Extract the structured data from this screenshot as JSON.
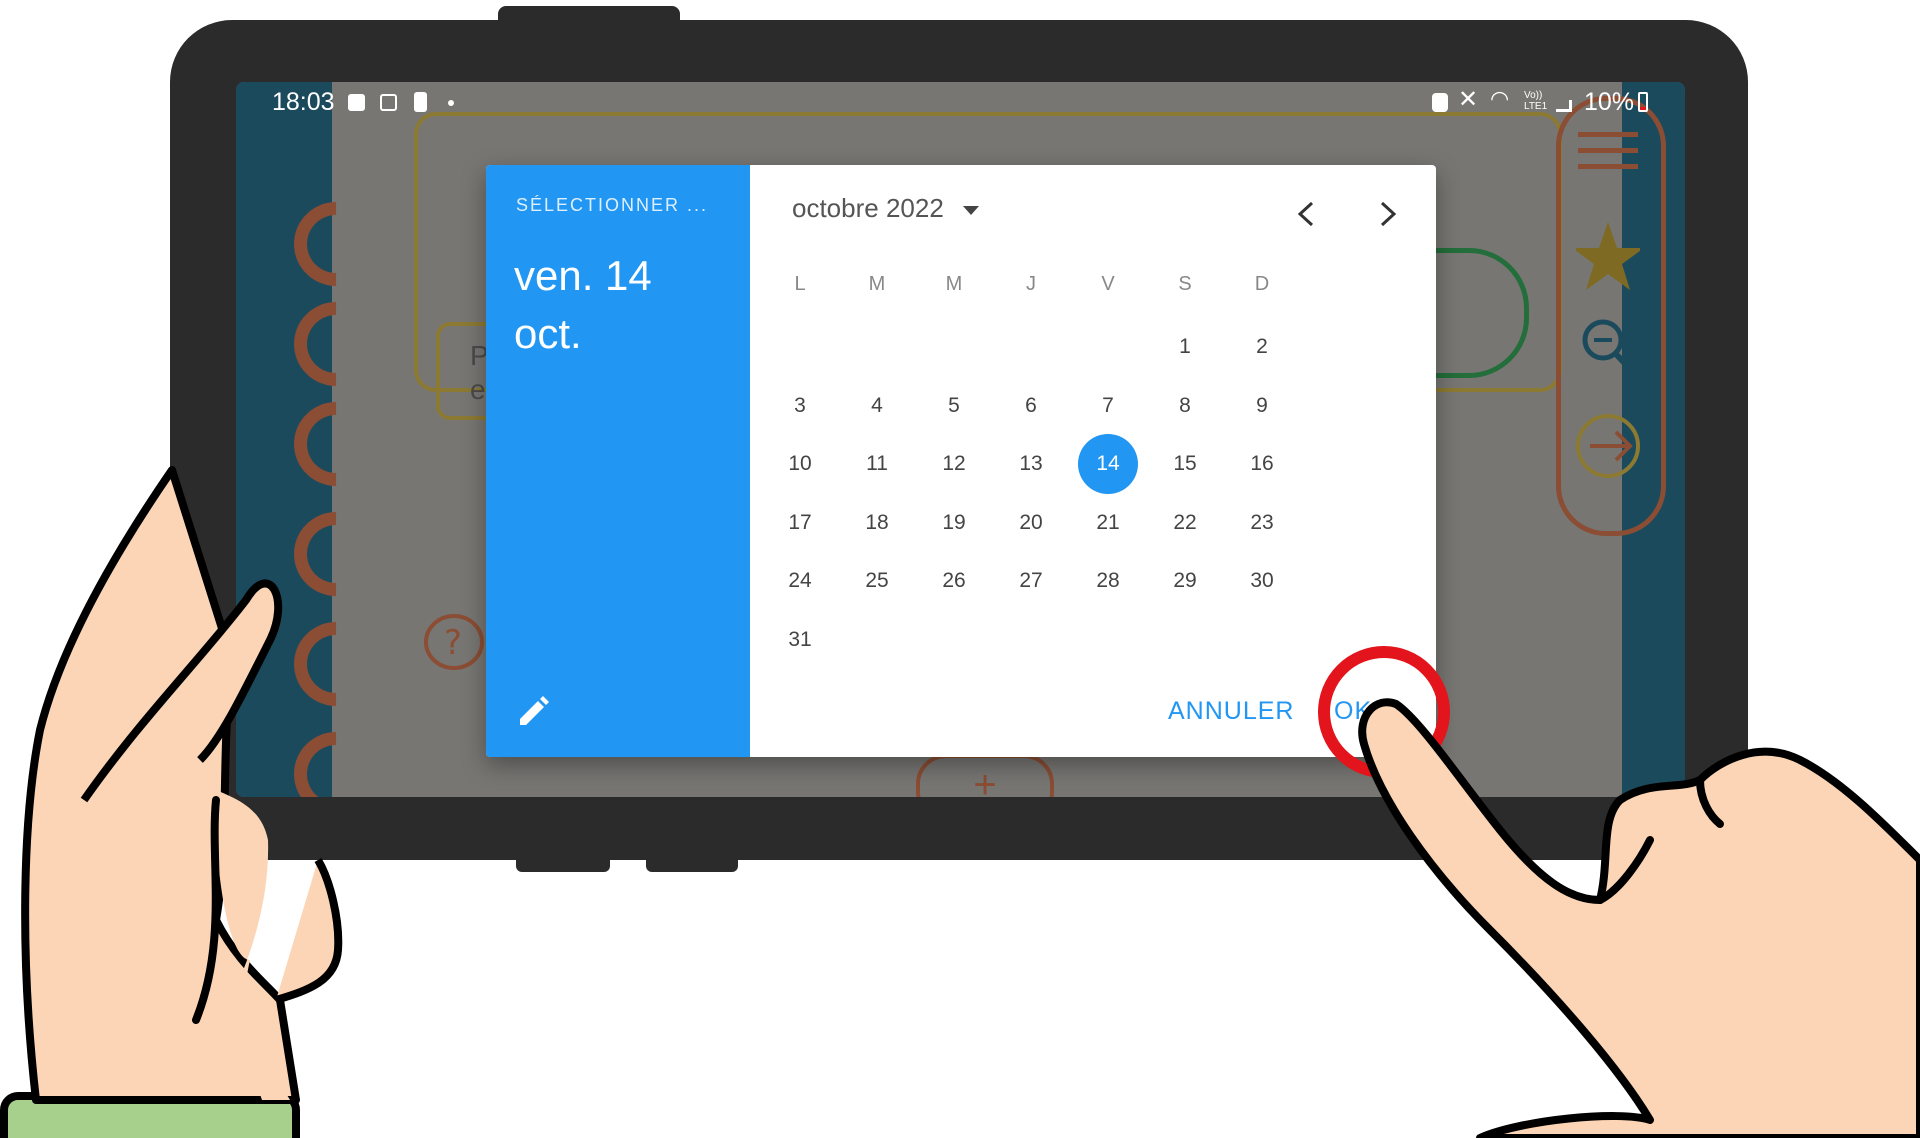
{
  "status_bar": {
    "time": "18:03",
    "left_icons": [
      "notification-icon",
      "image-icon",
      "battery-alert-icon",
      "dot-icon"
    ],
    "right_icons": [
      "vpn-icon",
      "mute-icon",
      "wifi-icon",
      "volte-icon",
      "signal-icon"
    ],
    "volte_label": "Vo)) LTE1",
    "battery": "10%"
  },
  "app_background": {
    "card_text_1": "P",
    "card_text_2": "e",
    "add_symbol": "+"
  },
  "dialog": {
    "header_label": "SÉLECTIONNER ...",
    "selected_date_line1": "ven. 14",
    "selected_date_line2": "oct.",
    "month_label": "octobre 2022",
    "prev_icon": "chevron-left-icon",
    "next_icon": "chevron-right-icon",
    "weekdays": [
      "L",
      "M",
      "M",
      "J",
      "V",
      "S",
      "D"
    ],
    "days": [
      "1",
      "2",
      "3",
      "4",
      "5",
      "6",
      "7",
      "8",
      "9",
      "10",
      "11",
      "12",
      "13",
      "14",
      "15",
      "16",
      "17",
      "18",
      "19",
      "20",
      "21",
      "22",
      "23",
      "24",
      "25",
      "26",
      "27",
      "28",
      "29",
      "30",
      "31"
    ],
    "first_weekday_index": 5,
    "selected_day": "14",
    "cancel_label": "ANNULER",
    "ok_label": "OK"
  },
  "colors": {
    "accent": "#2196f3",
    "highlight_ring": "#e3141b",
    "frame": "#2b2b2b",
    "skin": "#fbd5b5",
    "sleeve": "#a8d08d",
    "app_sidebar": "#1c4a5d",
    "app_orange": "#8b4d33"
  }
}
